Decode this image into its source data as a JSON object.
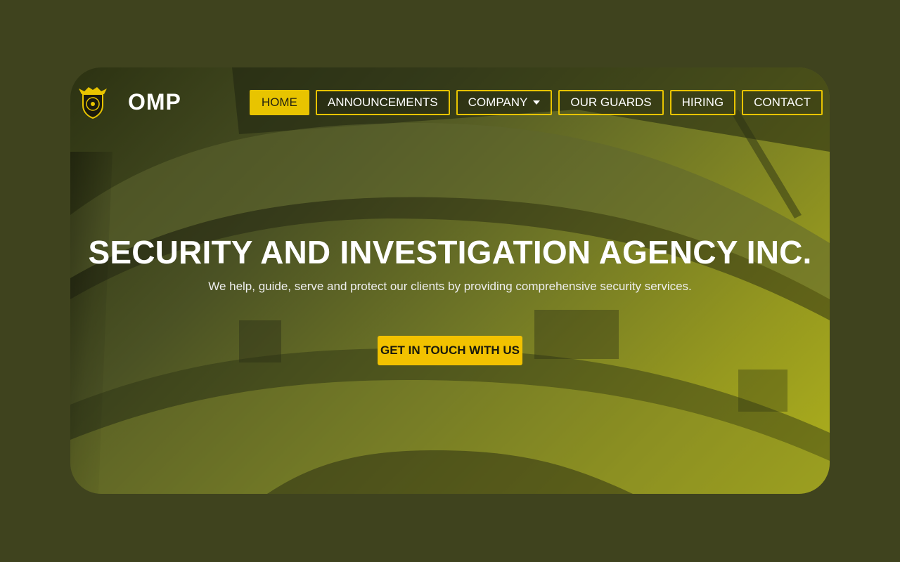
{
  "brand": {
    "name": "OMP",
    "logo_icon": "eagle-shield-icon"
  },
  "nav": {
    "items": [
      {
        "label": "HOME",
        "active": true
      },
      {
        "label": "ANNOUNCEMENTS",
        "active": false
      },
      {
        "label": "COMPANY",
        "active": false,
        "dropdown": true
      },
      {
        "label": "OUR GUARDS",
        "active": false
      },
      {
        "label": "HIRING",
        "active": false
      },
      {
        "label": "CONTACT",
        "active": false
      }
    ]
  },
  "hero": {
    "title": "SECURITY AND INVESTIGATION AGENCY INC.",
    "subtitle": "We help, guide, serve and protect our clients by providing comprehensive security services.",
    "cta_label": "GET IN TOUCH WITH US"
  },
  "colors": {
    "page_background": "#3f431e",
    "accent": "#e8c400",
    "cta": "#f2c200",
    "text": "#ffffff"
  }
}
